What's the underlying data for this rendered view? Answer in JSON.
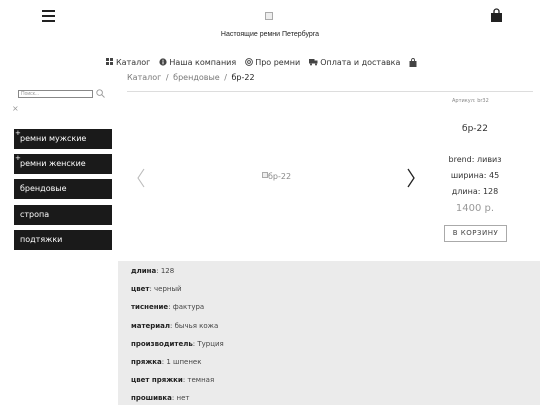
{
  "header": {
    "site_name": "Настоящие ремни Петербурга",
    "menu_icon": "hamburger-menu-icon",
    "cart_icon": "shopping-bag-icon",
    "logo_icon": "broken-image-icon"
  },
  "nav": {
    "items": [
      {
        "label": "Каталог",
        "icon": "grid-icon"
      },
      {
        "label": "Наша компания",
        "icon": "info-icon"
      },
      {
        "label": "Про ремни",
        "icon": "support-icon"
      },
      {
        "label": "Оплата и доставка",
        "icon": "truck-icon"
      }
    ],
    "cart_icon": "shopping-bag-icon"
  },
  "breadcrumb": {
    "items": [
      "Каталог",
      "брендовые",
      "бр-22"
    ],
    "separator": "/"
  },
  "sidebar": {
    "search_placeholder": "Поиск...",
    "close_label": "×",
    "items": [
      {
        "label": "ремни мужские",
        "expandable": true
      },
      {
        "label": "ремни женские",
        "expandable": true
      },
      {
        "label": "брендовые",
        "expandable": false
      },
      {
        "label": "стропа",
        "expandable": false
      },
      {
        "label": "подтяжки",
        "expandable": false
      }
    ],
    "plus_label": "+"
  },
  "product": {
    "image_alt": "бр-22",
    "article": "Артикул: br32",
    "title": "бр-22",
    "brand": "brend: ливиз",
    "width": "ширина: 45",
    "length": "длина: 128",
    "price": "1400 р.",
    "buy_label": "В КОРЗИНУ"
  },
  "specs": [
    {
      "key": "длина",
      "value": ": 128"
    },
    {
      "key": "цвет",
      "value": ": черный"
    },
    {
      "key": "тиснение",
      "value": ": фактура"
    },
    {
      "key": "материал",
      "value": ": бычья кожа"
    },
    {
      "key": "производитель",
      "value": ": Турция"
    },
    {
      "key": "пряжка",
      "value": ": 1 шпенек"
    },
    {
      "key": "цвет пряжки",
      "value": ": темная"
    },
    {
      "key": "прошивка",
      "value": ": нет"
    }
  ],
  "colors": {
    "sidebar_bg": "#1a1a1a",
    "specs_bg": "#ebebeb",
    "price": "#999999"
  }
}
